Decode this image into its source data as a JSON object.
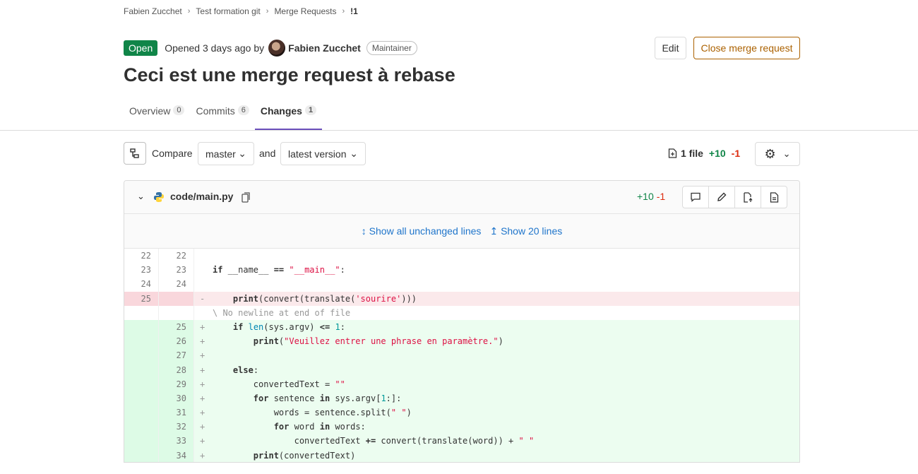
{
  "breadcrumb": [
    "Fabien Zucchet",
    "Test formation git",
    "Merge Requests",
    "!1"
  ],
  "mr": {
    "status": "Open",
    "opened_text": "Opened 3 days ago by",
    "author": "Fabien Zucchet",
    "role": "Maintainer",
    "title": "Ceci est une merge request à rebase"
  },
  "actions": {
    "edit": "Edit",
    "close": "Close merge request"
  },
  "tabs": [
    {
      "label": "Overview",
      "count": "0"
    },
    {
      "label": "Commits",
      "count": "6"
    },
    {
      "label": "Changes",
      "count": "1"
    }
  ],
  "compare": {
    "label": "Compare",
    "from": "master",
    "and": "and",
    "to": "latest version"
  },
  "stats": {
    "files": "1 file",
    "added": "+10",
    "removed": "-1"
  },
  "file": {
    "path": "code/main.py",
    "added": "+10",
    "removed": "-1"
  },
  "expand": {
    "all": "Show all unchanged lines",
    "twenty": "Show 20 lines"
  },
  "diff": [
    {
      "type": "ctx",
      "old": "22",
      "new": "22",
      "text": ""
    },
    {
      "type": "ctx",
      "old": "23",
      "new": "23",
      "text": "if __name__ == \"__main__\":"
    },
    {
      "type": "ctx",
      "old": "24",
      "new": "24",
      "text": ""
    },
    {
      "type": "del",
      "old": "25",
      "new": "",
      "text": "    print(convert(translate('sourire')))"
    },
    {
      "type": "meta",
      "old": "",
      "new": "",
      "text": "\\ No newline at end of file"
    },
    {
      "type": "add",
      "old": "",
      "new": "25",
      "text": "    if len(sys.argv) <= 1:"
    },
    {
      "type": "add",
      "old": "",
      "new": "26",
      "text": "        print(\"Veuillez entrer une phrase en paramètre.\")"
    },
    {
      "type": "add",
      "old": "",
      "new": "27",
      "text": ""
    },
    {
      "type": "add",
      "old": "",
      "new": "28",
      "text": "    else:"
    },
    {
      "type": "add",
      "old": "",
      "new": "29",
      "text": "        convertedText = \"\""
    },
    {
      "type": "add",
      "old": "",
      "new": "30",
      "text": "        for sentence in sys.argv[1:]:"
    },
    {
      "type": "add",
      "old": "",
      "new": "31",
      "text": "            words = sentence.split(\" \")"
    },
    {
      "type": "add",
      "old": "",
      "new": "32",
      "text": "            for word in words:"
    },
    {
      "type": "add",
      "old": "",
      "new": "33",
      "text": "                convertedText += convert(translate(word)) + \" \""
    },
    {
      "type": "add",
      "old": "",
      "new": "34",
      "text": "        print(convertedText)"
    }
  ]
}
